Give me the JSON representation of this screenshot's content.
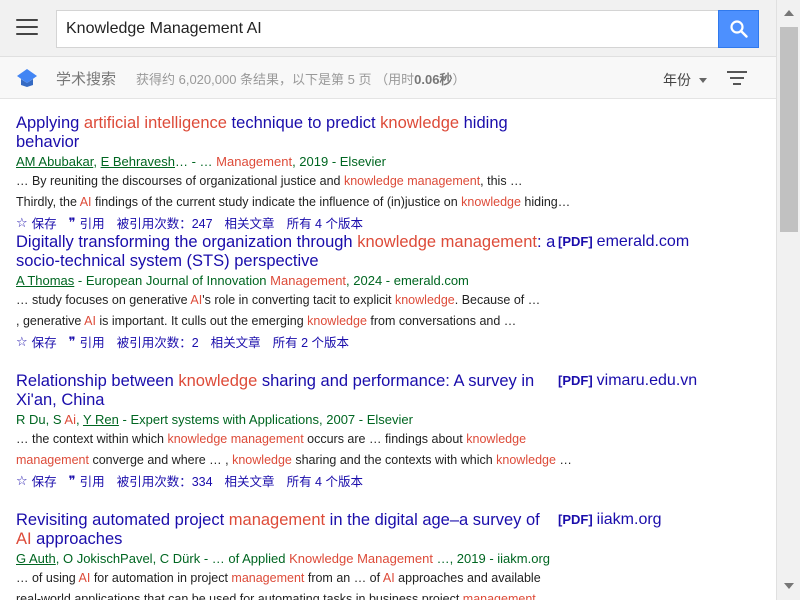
{
  "search": {
    "query": "Knowledge Management AI"
  },
  "subbar": {
    "brand": "学术搜索",
    "stats_prefix": "获得约 6,020,000 条结果，以下是第 5 页  （用时",
    "stats_time": "0.06秒",
    "stats_suffix": "）",
    "year_filter": "年份"
  },
  "icons": {
    "menu": "hamburger-icon",
    "search": "search-icon",
    "logo": "scholar-logo-icon",
    "filter": "filter-lines-icon",
    "save": "star-icon",
    "cite": "quote-icon"
  },
  "colors": {
    "link": "#1a0dab",
    "highlight": "#dd4b39",
    "meta": "#006621",
    "search_button": "#4d90fe"
  },
  "results": [
    {
      "title": [
        {
          "t": "Applying ",
          "h": false
        },
        {
          "t": "artificial intelligence",
          "h": true
        },
        {
          "t": " technique to predict ",
          "h": false
        },
        {
          "t": "knowledge",
          "h": true
        },
        {
          "t": " hiding behavior",
          "h": false
        }
      ],
      "pdf": null,
      "meta": [
        {
          "t": "AM Abubakar",
          "a": true
        },
        {
          "t": ", ",
          "a": false
        },
        {
          "t": "E Behravesh",
          "a": true
        },
        {
          "t": "… - … ",
          "a": false
        },
        {
          "t": "Management",
          "h": true
        },
        {
          "t": ", 2019 - Elsevier",
          "a": false
        }
      ],
      "snippet": [
        [
          {
            "t": "… By reuniting the discourses of organizational justice and ",
            "h": false
          },
          {
            "t": "knowledge management",
            "h": true
          },
          {
            "t": ", this …",
            "h": false
          }
        ],
        [
          {
            "t": "Thirdly, the ",
            "h": false
          },
          {
            "t": "AI",
            "h": true
          },
          {
            "t": " findings of the current study indicate the influence of (in)justice on ",
            "h": false
          },
          {
            "t": "knowledge",
            "h": true
          },
          {
            "t": " hiding…",
            "h": false
          }
        ]
      ],
      "actions": {
        "save": "保存",
        "cite": "引用",
        "cited_by": "被引用次数：247",
        "related": "相关文章",
        "versions": "所有 4 个版本"
      }
    },
    {
      "title": [
        {
          "t": "Digitally transforming the organization through ",
          "h": false
        },
        {
          "t": "knowledge management",
          "h": true
        },
        {
          "t": ": a socio-technical system (STS) perspective",
          "h": false
        }
      ],
      "pdf": {
        "tag": "[PDF]",
        "domain": "emerald.com"
      },
      "meta": [
        {
          "t": "A Thomas",
          "a": true
        },
        {
          "t": " - European Journal of Innovation ",
          "a": false
        },
        {
          "t": "Management",
          "h": true
        },
        {
          "t": ", 2024 - emerald.com",
          "a": false
        }
      ],
      "snippet": [
        [
          {
            "t": "… study focuses on generative ",
            "h": false
          },
          {
            "t": "AI",
            "h": true
          },
          {
            "t": "'s role in converting tacit to explicit ",
            "h": false
          },
          {
            "t": "knowledge",
            "h": true
          },
          {
            "t": ". Because of …",
            "h": false
          }
        ],
        [
          {
            "t": ", generative ",
            "h": false
          },
          {
            "t": "AI",
            "h": true
          },
          {
            "t": " is important. It culls out the emerging ",
            "h": false
          },
          {
            "t": "knowledge",
            "h": true
          },
          {
            "t": " from conversations and …",
            "h": false
          }
        ]
      ],
      "actions": {
        "save": "保存",
        "cite": "引用",
        "cited_by": "被引用次数：2",
        "related": "相关文章",
        "versions": "所有 2 个版本"
      }
    },
    {
      "title": [
        {
          "t": "Relationship between ",
          "h": false
        },
        {
          "t": "knowledge",
          "h": true
        },
        {
          "t": " sharing and performance: A survey in Xi'an, China",
          "h": false
        }
      ],
      "pdf": {
        "tag": "[PDF]",
        "domain": "vimaru.edu.vn"
      },
      "meta": [
        {
          "t": "R Du, S ",
          "a": false
        },
        {
          "t": "Ai",
          "h": true
        },
        {
          "t": ", ",
          "a": false
        },
        {
          "t": "Y Ren",
          "a": true
        },
        {
          "t": " - Expert systems with Applications, 2007 - Elsevier",
          "a": false
        }
      ],
      "snippet": [
        [
          {
            "t": "… the context within which ",
            "h": false
          },
          {
            "t": "knowledge management",
            "h": true
          },
          {
            "t": " occurs are … findings about ",
            "h": false
          },
          {
            "t": "knowledge",
            "h": true
          }
        ],
        [
          {
            "t": "management",
            "h": true
          },
          {
            "t": " converge and where … , ",
            "h": false
          },
          {
            "t": "knowledge",
            "h": true
          },
          {
            "t": " sharing and the contexts with which ",
            "h": false
          },
          {
            "t": "knowledge",
            "h": true
          },
          {
            "t": " …",
            "h": false
          }
        ]
      ],
      "actions": {
        "save": "保存",
        "cite": "引用",
        "cited_by": "被引用次数：334",
        "related": "相关文章",
        "versions": "所有 4 个版本"
      }
    },
    {
      "title": [
        {
          "t": "Revisiting automated project ",
          "h": false
        },
        {
          "t": "management",
          "h": true
        },
        {
          "t": " in the digital age–a survey of ",
          "h": false
        },
        {
          "t": "AI",
          "h": true
        },
        {
          "t": " approaches",
          "h": false
        }
      ],
      "pdf": {
        "tag": "[PDF]",
        "domain": "iiakm.org"
      },
      "meta": [
        {
          "t": "G Auth",
          "a": true
        },
        {
          "t": ", O JokischPavel, C Dürk - … of Applied ",
          "a": false
        },
        {
          "t": "Knowledge Management",
          "h": true
        },
        {
          "t": " …, 2019 - iiakm.org",
          "a": false
        }
      ],
      "snippet": [
        [
          {
            "t": "… of using ",
            "h": false
          },
          {
            "t": "AI",
            "h": true
          },
          {
            "t": " for automation in project ",
            "h": false
          },
          {
            "t": "management",
            "h": true
          },
          {
            "t": " from an … of ",
            "h": false
          },
          {
            "t": "AI",
            "h": true
          },
          {
            "t": " approaches and available",
            "h": false
          }
        ],
        [
          {
            "t": "real-world applications that can be used for automating tasks in business project ",
            "h": false
          },
          {
            "t": "management",
            "h": true
          },
          {
            "t": " …",
            "h": false
          }
        ]
      ],
      "actions": null
    }
  ]
}
